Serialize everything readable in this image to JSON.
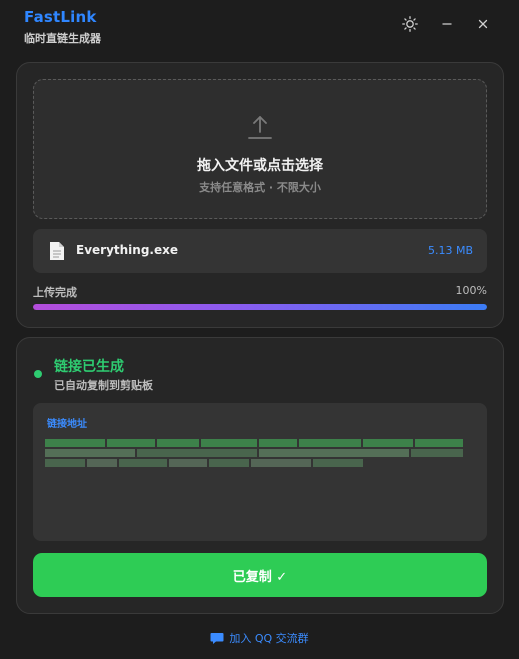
{
  "app": {
    "title": "FastLink",
    "subtitle": "临时直链生成器"
  },
  "window_controls": {
    "theme_icon": "sun-icon",
    "minimize_icon": "minimize-icon",
    "close_icon": "close-icon"
  },
  "upload": {
    "dropzone_icon": "upload-icon",
    "dropzone_title": "拖入文件或点击选择",
    "dropzone_hint": "支持任意格式 · 不限大小",
    "file_icon": "file-icon",
    "file_name": "Everything.exe",
    "file_size": "5.13 MB",
    "progress_label": "上传完成",
    "progress_text": "100%",
    "progress_value": 1.0
  },
  "link": {
    "status_title": "链接已生成",
    "status_subtitle": "已自动复制到剪贴板",
    "box_label": "链接地址",
    "copy_button": "已复制 ✓"
  },
  "footer": {
    "icon": "chat-bubble-icon",
    "text": "加入 QQ 交流群"
  },
  "colors": {
    "accent_blue": "#3b8cff",
    "success_green": "#2ecc55",
    "background": "#1d1d1d",
    "card": "#262626"
  }
}
